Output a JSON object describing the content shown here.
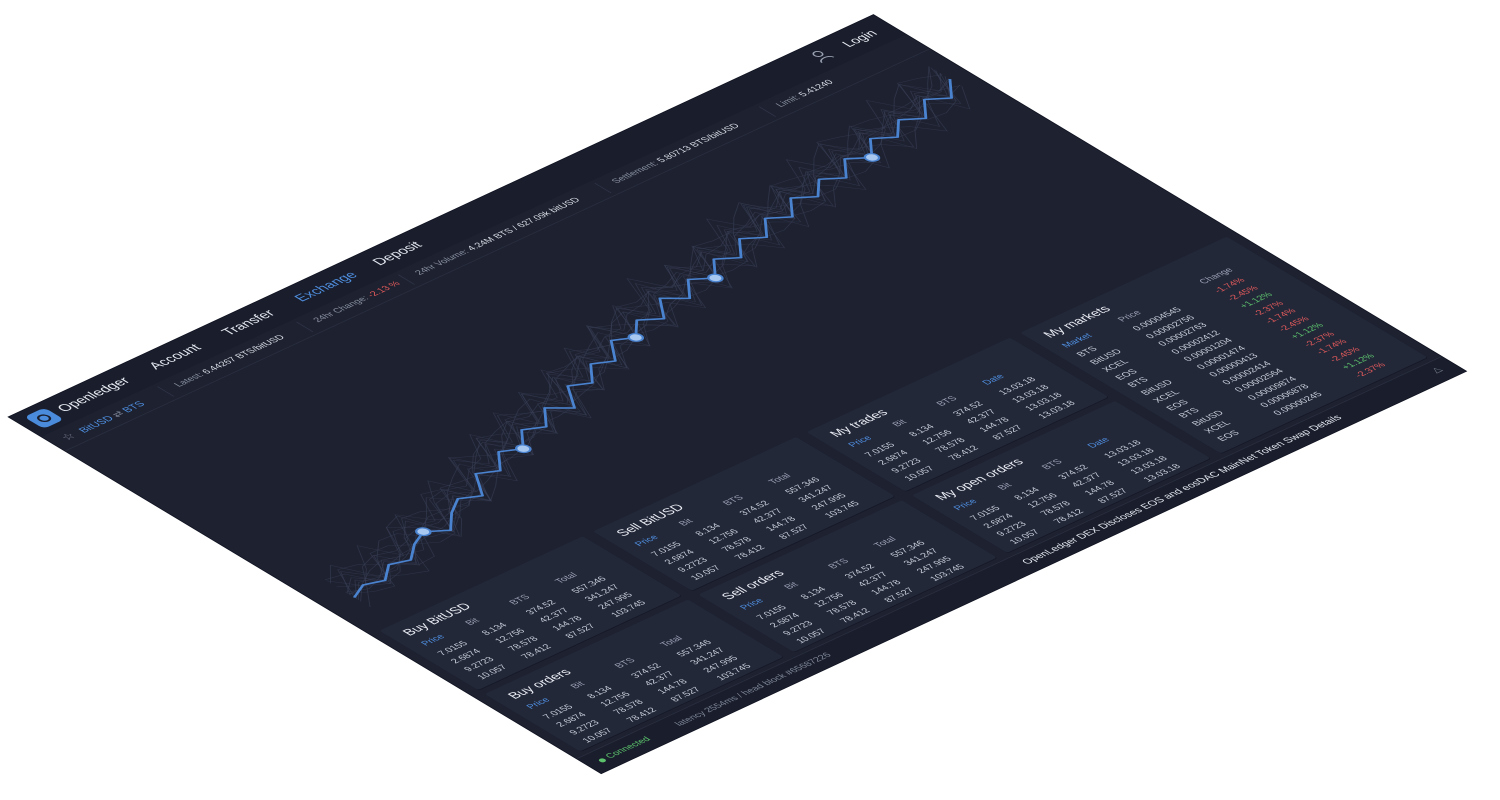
{
  "header": {
    "brand": "Openledger",
    "nav": [
      "Account",
      "Transfer",
      "Exchange",
      "Deposit"
    ],
    "active_nav": "Exchange",
    "login": "Login"
  },
  "stats": {
    "pair_base": "BitUSD",
    "pair_quote": "BTS",
    "latest_label": "Latest:",
    "latest_value": "6.44267 BTS/bitUSD",
    "change_label": "24hr Change:",
    "change_value": "-2.13 %",
    "volume_label": "24hr Volume:",
    "volume_value": "4.24M BTS / 627.09k bitUSD",
    "settlement_label": "Settlement:",
    "settlement_value": "5.80713 BTS/bitUSD",
    "limit_label": "Limit:",
    "limit_value": "5.41240"
  },
  "order_rows": [
    [
      "7.0155",
      "8.134",
      "374.52",
      "557.346"
    ],
    [
      "2.6874",
      "12.756",
      "42.377",
      "341.247"
    ],
    [
      "9.2723",
      "78.578",
      "144.78",
      "247.995"
    ],
    [
      "10.057",
      "78.412",
      "87.527",
      "103.745"
    ]
  ],
  "trade_rows": [
    [
      "7.0155",
      "8.134",
      "374.52",
      "13.03.18"
    ],
    [
      "2.6874",
      "12.756",
      "42.377",
      "13.03.18"
    ],
    [
      "9.2723",
      "78.578",
      "144.78",
      "13.03.18"
    ],
    [
      "10.057",
      "78.412",
      "87.527",
      "13.03.18"
    ]
  ],
  "panels": {
    "buy": {
      "title": "Buy BitUSD",
      "cols": [
        "Price",
        "Bit",
        "BTS",
        "Total"
      ]
    },
    "sell": {
      "title": "Sell BitUSD",
      "cols": [
        "Price",
        "Bit",
        "BTS",
        "Total"
      ]
    },
    "buy_orders": {
      "title": "Buy orders",
      "cols": [
        "Price",
        "Bit",
        "BTS",
        "Total"
      ]
    },
    "sell_orders": {
      "title": "Sell orders",
      "cols": [
        "Price",
        "Bit",
        "BTS",
        "Total"
      ]
    },
    "my_trades": {
      "title": "My trades",
      "cols": [
        "Price",
        "Bit",
        "BTS",
        "Date"
      ]
    },
    "my_open_orders": {
      "title": "My open orders",
      "cols": [
        "Price",
        "Bit",
        "BTS",
        "Date"
      ]
    },
    "my_markets": {
      "title": "My markets",
      "cols": [
        "Market",
        "Price",
        "Change"
      ],
      "rows": [
        [
          "BTS",
          "0.00004545",
          "-1.74%"
        ],
        [
          "BitUSD",
          "0.00002756",
          "-2.45%"
        ],
        [
          "XCEL",
          "0.00002763",
          "+1.12%"
        ],
        [
          "EOS",
          "0.00002412",
          "-2.37%"
        ],
        [
          "BTS",
          "0.00001204",
          "-1.74%"
        ],
        [
          "BitUSD",
          "0.00001474",
          "-2.45%"
        ],
        [
          "XCEL",
          "0.00000413",
          "+1.12%"
        ],
        [
          "EOS",
          "0.00002414",
          "-2.37%"
        ],
        [
          "BTS",
          "0.00002564",
          "-1.74%"
        ],
        [
          "BitUSD",
          "0.00009874",
          "-2.45%"
        ],
        [
          "XCEL",
          "0.00006878",
          "+1.12%"
        ],
        [
          "EOS",
          "0.00000245",
          "-2.37%"
        ]
      ]
    }
  },
  "news": "OpenLedger DEX Discloses EOS and eosDAC MainNet Token Swap Details",
  "footer": {
    "status": "Connected",
    "latency": "latency 2554ms / head block #65687226"
  },
  "colors": {
    "background": "#1d2130",
    "panel": "#232839",
    "accent": "#4f8fe0",
    "negative": "#e25a5a",
    "positive": "#5cc36c"
  },
  "chart_data": {
    "type": "line",
    "series_points": [
      0.06,
      0.09,
      0.07,
      0.12,
      0.1,
      0.15,
      0.18,
      0.14,
      0.2,
      0.24,
      0.21,
      0.3,
      0.27,
      0.34,
      0.31,
      0.38,
      0.35,
      0.42,
      0.37,
      0.46,
      0.43,
      0.5,
      0.47,
      0.55,
      0.52,
      0.58,
      0.54,
      0.62,
      0.57,
      0.64,
      0.6,
      0.67,
      0.63,
      0.7,
      0.66,
      0.73,
      0.69,
      0.76,
      0.72,
      0.78,
      0.74,
      0.81,
      0.77,
      0.84,
      0.8,
      0.86,
      0.82,
      0.89,
      0.85,
      0.92
    ],
    "markers": [
      6,
      14,
      24,
      30,
      42
    ]
  }
}
